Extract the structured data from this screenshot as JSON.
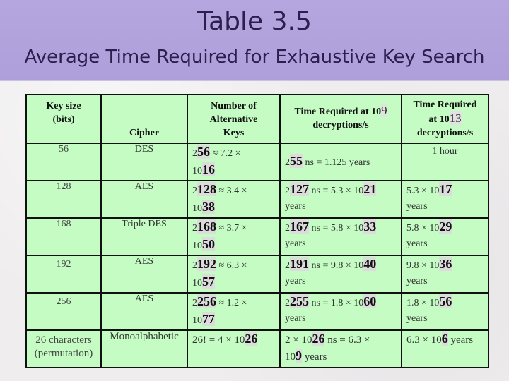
{
  "slide": {
    "title": "Table 3.5",
    "subtitle": "Average Time Required for Exhaustive Key Search"
  },
  "colors": {
    "header_band": "#b2a3dd",
    "title_text": "#2a1f4f",
    "table_background": "#c4fcc4",
    "exponent_highlight": "#dcdcdc",
    "page_background": "#efeded"
  },
  "table": {
    "headers": {
      "key_size": [
        "Key size",
        "(bits)"
      ],
      "cipher": "Cipher",
      "alt_keys": [
        "Number of",
        "Alternative",
        "Keys"
      ],
      "time_1e9": {
        "pre": "Time Required at 10",
        "exp": "9",
        "post": "decryptions/s"
      },
      "time_1e13": {
        "line1": "Time Required",
        "pre": "at 10",
        "exp": "13",
        "post": "decryptions/s"
      }
    },
    "rows": [
      {
        "key_size": "56",
        "cipher": "DES",
        "alt_keys": {
          "base": "2",
          "exp": "56",
          "approx": " ≈ 7.2 ×",
          "base2": "10",
          "exp2": "16"
        },
        "time_1e9": {
          "base": "2",
          "exp": "55",
          "rest": " ns = 1.125 years"
        },
        "time_1e13": {
          "text": "1 hour"
        }
      },
      {
        "key_size": "128",
        "cipher": "AES",
        "alt_keys": {
          "base": "2",
          "exp": "128",
          "approx": " ≈ 3.4 ×",
          "base2": "10",
          "exp2": "38"
        },
        "time_1e9": {
          "base": "2",
          "exp": "127",
          "rest": " ns = 5.3 × 10",
          "exp2": "21",
          "tail": "years"
        },
        "time_1e13": {
          "mant": "5.3 × 10",
          "exp": "17",
          "tail": "years"
        }
      },
      {
        "key_size": "168",
        "cipher": "Triple DES",
        "alt_keys": {
          "base": "2",
          "exp": "168",
          "approx": " ≈ 3.7 ×",
          "base2": "10",
          "exp2": "50"
        },
        "time_1e9": {
          "base": "2",
          "exp": "167",
          "rest": " ns = 5.8 × 10",
          "exp2": "33",
          "tail": "years"
        },
        "time_1e13": {
          "mant": "5.8 × 10",
          "exp": "29",
          "tail": "years"
        }
      },
      {
        "key_size": "192",
        "cipher": "AES",
        "alt_keys": {
          "base": "2",
          "exp": "192",
          "approx": " ≈ 6.3 ×",
          "base2": "10",
          "exp2": "57"
        },
        "time_1e9": {
          "base": "2",
          "exp": "191",
          "rest": " ns = 9.8 × 10",
          "exp2": "40",
          "tail": "years"
        },
        "time_1e13": {
          "mant": "9.8 × 10",
          "exp": "36",
          "tail": "years"
        }
      },
      {
        "key_size": "256",
        "cipher": "AES",
        "alt_keys": {
          "base": "2",
          "exp": "256",
          "approx": " ≈ 1.2 ×",
          "base2": "10",
          "exp2": "77"
        },
        "time_1e9": {
          "base": "2",
          "exp": "255",
          "rest": " ns = 1.8 × 10",
          "exp2": "60",
          "tail": "years"
        },
        "time_1e13": {
          "mant": "1.8 × 10",
          "exp": "56",
          "tail": "years"
        }
      },
      {
        "key_size": [
          "26 characters",
          "(permutation)"
        ],
        "cipher": "Monoalphabetic",
        "alt_keys": {
          "pre": "26! = 4 × 10",
          "exp": "26"
        },
        "time_1e9": {
          "pre": "2 × 10",
          "exp": "26",
          "mid": " ns = 6.3 ×",
          "base2": "10",
          "exp2": "9",
          "tail": " years"
        },
        "time_1e13": {
          "mant": "6.3 × 10",
          "exp": "6",
          "tail": " years"
        }
      }
    ]
  }
}
